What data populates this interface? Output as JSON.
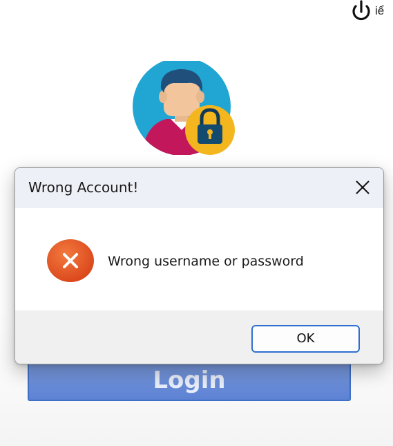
{
  "header": {
    "power_icon": "power-icon",
    "truncated_text": "iể"
  },
  "avatar": {
    "icon": "user-lock-avatar",
    "colors": {
      "circle": "#21a6d3",
      "lock": "#f3b61f",
      "shirt": "#c2185b"
    }
  },
  "login_button": {
    "label": "Login",
    "color": "#5d82d3"
  },
  "dialog": {
    "title": "Wrong Account!",
    "close_icon": "close-icon",
    "error_icon": "error-x-icon",
    "error_color": "#e5531f",
    "message": "Wrong username or password",
    "ok_label": "OK",
    "accent": "#2f6fd3"
  }
}
